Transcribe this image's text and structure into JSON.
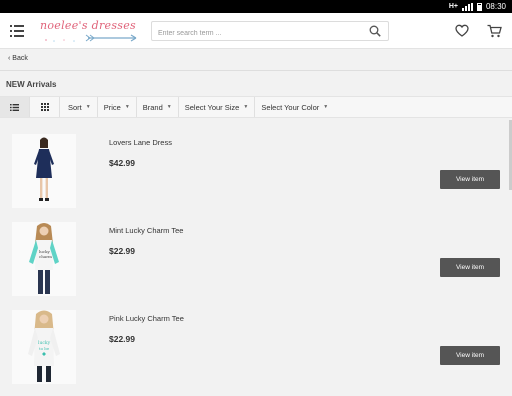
{
  "status": {
    "network": "H+",
    "time": "08:30"
  },
  "header": {
    "logo_text": "noelee's dresses",
    "search_placeholder": "Enter search term ..."
  },
  "nav": {
    "back_label": "Back"
  },
  "section_title": "NEW Arrivals",
  "toolbar": {
    "filters": [
      "Sort",
      "Price",
      "Brand",
      "Select Your Size",
      "Select Your Color"
    ]
  },
  "products": [
    {
      "name": "Lovers Lane Dress",
      "price": "$42.99",
      "button": "View item"
    },
    {
      "name": "Mint Lucky Charm Tee",
      "price": "$22.99",
      "button": "View item"
    },
    {
      "name": "Pink Lucky Charm Tee",
      "price": "$22.99",
      "button": "View item"
    }
  ],
  "colors": {
    "brand_pink": "#e0637a",
    "button_bg": "#555555",
    "dress_navy": "#1e2e5a",
    "mint": "#5fd3c6",
    "pink_print": "#3bbfae"
  }
}
